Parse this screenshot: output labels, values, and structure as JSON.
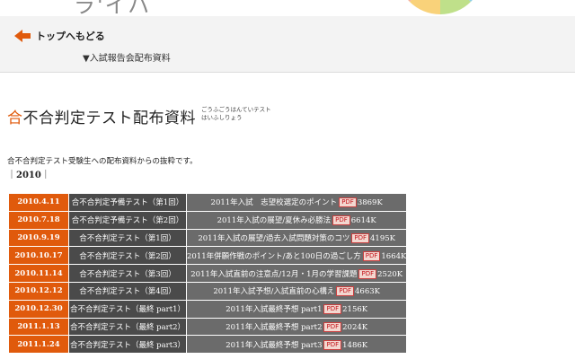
{
  "header": {
    "brand_fragment": "ラ'イハ"
  },
  "nav": {
    "back_label": "トップへもどる",
    "breadcrumb": "▼入試報告会配布資料"
  },
  "page": {
    "title_accent": "合",
    "title_rest": "不合判定テスト配布資料",
    "title_reading_line1": "ごうふごうはんていテスト",
    "title_reading_line2": "はいふしりょう",
    "intro": "合不合判定テスト受験生への配布資料からの抜粋です。",
    "year_open": "｜",
    "year": "2010",
    "year_close": "｜"
  },
  "icons": {
    "back": "left-arrow-icon",
    "pdf": "pdf-icon"
  },
  "colors": {
    "accent": "#e05a0c",
    "test_cell": "#4a4a4a",
    "doc_cell": "#6b6b6b",
    "pdf_red": "#c4141a"
  },
  "table": {
    "pdf_label": "PDF",
    "rows": [
      {
        "date": "2010.4.11",
        "test": "合不合判定予備テスト（第1回）",
        "doc": "2011年入試　志望校選定のポイント",
        "size": "3869K"
      },
      {
        "date": "2010.7.18",
        "test": "合不合判定予備テスト（第2回）",
        "doc": "2011年入試の展望/夏休み必勝法",
        "size": "6614K"
      },
      {
        "date": "2010.9.19",
        "test": "合不合判定テスト（第1回）",
        "doc": "2011年入試の展望/過去入試問題対策のコツ",
        "size": "4195K"
      },
      {
        "date": "2010.10.17",
        "test": "合不合判定テスト（第2回）",
        "doc": "2011年併願作戦のポイント/あと100日の過ごし方",
        "size": "1664K"
      },
      {
        "date": "2010.11.14",
        "test": "合不合判定テスト（第3回）",
        "doc": "2011年入試直前の注意点/12月・1月の学習課題",
        "size": "2520K"
      },
      {
        "date": "2010.12.12",
        "test": "合不合判定テスト（第4回）",
        "doc": "2011年入試予想/入試直前の心構え",
        "size": "4663K"
      },
      {
        "date": "2010.12.30",
        "test": "合不合判定テスト（最終 part1）",
        "doc": "2011年入試最終予想 part1",
        "size": "2156K"
      },
      {
        "date": "2011.1.13",
        "test": "合不合判定テスト（最終 part2）",
        "doc": "2011年入試最終予想 part2",
        "size": "2024K"
      },
      {
        "date": "2011.1.24",
        "test": "合不合判定テスト（最終 part3）",
        "doc": "2011年入試最終予想 part3",
        "size": "1486K"
      }
    ]
  }
}
